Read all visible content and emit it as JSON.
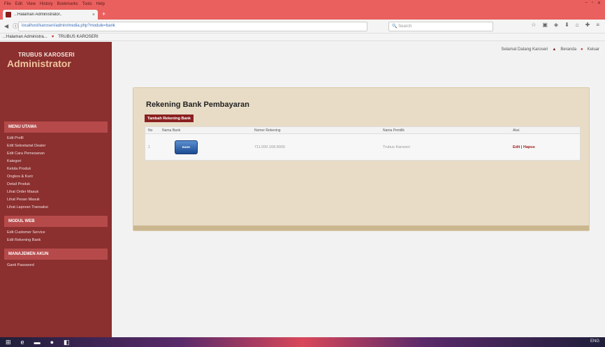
{
  "browser": {
    "menu": [
      "File",
      "Edit",
      "View",
      "History",
      "Bookmarks",
      "Tools",
      "Help"
    ],
    "tab_title": "..:Halaman Administrator..",
    "url": "localhost/karoseri/admin/media.php?module=bank",
    "search_placeholder": "Search",
    "bookmark_tab": "..:Halaman Administra...",
    "bookmark_link": "TRUBUS KAROSERI"
  },
  "sidebar": {
    "brand_small": "TRUBUS KAROSERI",
    "brand_big": "Administrator",
    "sections": [
      {
        "title": "MENU UTAMA",
        "items": [
          "Edit Profil",
          "Edit Sekretariat Dealer",
          "Edit Cara Pemesanan",
          "Kategori",
          "Kelola Produk",
          "Ongkos & Kurir",
          "Detail Produk",
          "Lihat Order Masuk",
          "Lihat Pesan Masuk",
          "Lihat Laporan Transaksi"
        ]
      },
      {
        "title": "MODUL WEB",
        "items": [
          "Edit Customer Service",
          "Edit Rekening Bank"
        ]
      },
      {
        "title": "MANAJEMEN AKUN",
        "items": [
          "Ganti Password"
        ]
      }
    ]
  },
  "header": {
    "welcome": "Selamat Datang Karoseri",
    "home": "Beranda",
    "logout": "Keluar"
  },
  "panel": {
    "title": "Rekening Bank Pembayaran",
    "add_button": "Tambah Rekening Bank",
    "columns": [
      "No",
      "Nama Bank",
      "Nomor Rekening",
      "Nama Pemilik",
      "Aksi"
    ],
    "rows": [
      {
        "no": "1",
        "bank_logo": "BANK",
        "rekening": "711.000.168.8000",
        "pemilik": "Trubus Karoseri",
        "aksi": "Edit | Hapus"
      }
    ]
  },
  "taskbar": {
    "tray": "ENG"
  },
  "colors": {
    "sidebar": "#8b2f2f",
    "section": "#b64a4a",
    "accent_brand": "#f2c49d",
    "panel_bg": "#e8dcc6",
    "chrome": "#e9605e"
  }
}
